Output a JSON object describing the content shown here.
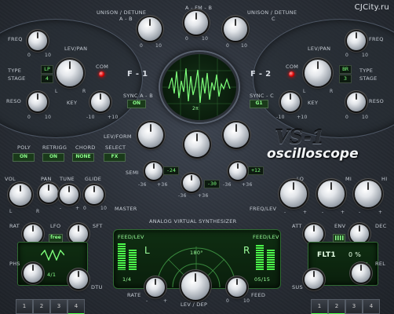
{
  "watermark": "CJCity.ru",
  "header": {
    "unison_detune_ab": "UNISON / DETUNE",
    "unison_detune_ab_sub": "A - B",
    "afm": "A - FM - B",
    "unison_detune_c": "UNISON / DETUNE",
    "unison_detune_c_sub": "C"
  },
  "f1": {
    "freq": "FREQ",
    "lev_pan": "LEV/PAN",
    "type": "TYPE",
    "stage": "STAGE",
    "type_value": "LP",
    "stage_value": "4",
    "com": "COM",
    "name": "F - 1",
    "reso": "RESO",
    "key": "KEY",
    "sync_ab": "SYNC A - B",
    "sync_value": "ON",
    "l": "L",
    "r": "R",
    "zero": "0",
    "ten": "10",
    "neg10": "-10",
    "pos10": "+10"
  },
  "f2": {
    "lev_pan": "LEV/PAN",
    "type": "TYPE",
    "stage": "STAGE",
    "type_value": "BR",
    "stage_value": "3",
    "com": "COM",
    "name": "F - 2",
    "freq": "FREQ",
    "reso": "RESO",
    "key": "KEY",
    "sync_c": "SYNC - C",
    "sync_value": "G1",
    "l": "L",
    "r": "R",
    "zero": "0",
    "ten": "10",
    "neg10": "-10",
    "pos10": "+10"
  },
  "scope": {
    "label": "2π"
  },
  "levform": {
    "label": "LEV/FORM",
    "semi": "SEMI",
    "semi_a": "-24",
    "semi_b": "-30",
    "semi_c": "+12",
    "r1": "-36",
    "r2": "+36"
  },
  "title": {
    "vs": "VS-1",
    "osc": "oscilloscope"
  },
  "buttons": {
    "poly": "POLY",
    "poly_v": "ON",
    "retrigg": "RETRIGG",
    "retrigg_v": "ON",
    "chord": "CHORD",
    "chord_v": "NONE",
    "select": "SELECT",
    "select_v": "FX"
  },
  "master": {
    "vol": "VOL",
    "pan": "PAN",
    "tune": "TUNE",
    "glide": "GLIDE",
    "master": "MASTER",
    "l": "L",
    "r": "R",
    "minus": "-",
    "plus": "+",
    "zero": "0",
    "ten": "10"
  },
  "eq": {
    "lo": "LO",
    "mi": "MI",
    "hi": "HI",
    "freq_lev": "FREQ/LEV",
    "minus": "-",
    "plus": "+"
  },
  "lfo": {
    "rat": "RAT",
    "lfo": "LFO",
    "sft": "SFT",
    "free": "free",
    "ratio": "4/1",
    "phs": "PHS",
    "dtu": "DTU"
  },
  "mid": {
    "subtitle": "ANALOG VIRTUAL SYNTHESIZER",
    "feed_lev_l": "FEED/LEV",
    "feed_lev_r": "FEED/LEV",
    "l": "L",
    "r": "R",
    "deg": "180°",
    "ratio_l": "1/4",
    "ratio_r": "05/15",
    "rate": "RATE",
    "lev_dep": "LEV / DEP",
    "feed": "FEED",
    "minus": "-",
    "plus": "+",
    "zero": "0",
    "ten": "10"
  },
  "env": {
    "att": "ATT",
    "env": "ENV",
    "dec": "DEC",
    "flt": "FLT1",
    "pct": "0 %",
    "sus": "SUS",
    "rel": "REL"
  },
  "tabs_left": [
    "1",
    "2",
    "3",
    "4"
  ],
  "tabs_right": [
    "1",
    "2",
    "3",
    "4"
  ]
}
